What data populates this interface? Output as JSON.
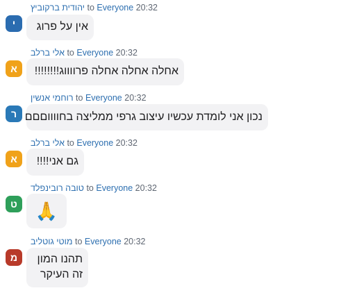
{
  "messages": [
    {
      "avatar_letter": "י",
      "avatar_color": "#2b6cb0",
      "sender": "יהודית ברקוביץ",
      "to_word": "to",
      "recipient": "Everyone",
      "time": "20:32",
      "lines": [
        "אין על פרוג"
      ]
    },
    {
      "avatar_letter": "א",
      "avatar_color": "#f0a21a",
      "sender": "אלי ברלב",
      "to_word": "to",
      "recipient": "Everyone",
      "time": "20:32",
      "lines": [
        "אחלה אחלה אחלה פרווווג!!!!!!!!"
      ]
    },
    {
      "avatar_letter": "ר",
      "avatar_color": "#2a79b7",
      "sender": "רוחמי אנשין",
      "to_word": "to",
      "recipient": "Everyone",
      "time": "20:32",
      "lines": [
        "נכון אני לומדת עכשיו עיצוב גרפי ממליצה בחווווםםם"
      ]
    },
    {
      "avatar_letter": "א",
      "avatar_color": "#f0a21a",
      "sender": "אלי ברלב",
      "to_word": "to",
      "recipient": "Everyone",
      "time": "20:32",
      "lines": [
        "גם אני!!!!"
      ]
    },
    {
      "avatar_letter": "ט",
      "avatar_color": "#2e9f5a",
      "sender": "טובה רובינפלד",
      "to_word": "to",
      "recipient": "Everyone",
      "time": "20:32",
      "lines": [
        "🙏"
      ]
    },
    {
      "avatar_letter": "מ",
      "avatar_color": "#b83a2a",
      "sender": "מוטי גוטליב",
      "to_word": "to",
      "recipient": "Everyone",
      "time": "20:32",
      "lines": [
        "תהנו המון",
        "זה העיקר"
      ]
    }
  ]
}
